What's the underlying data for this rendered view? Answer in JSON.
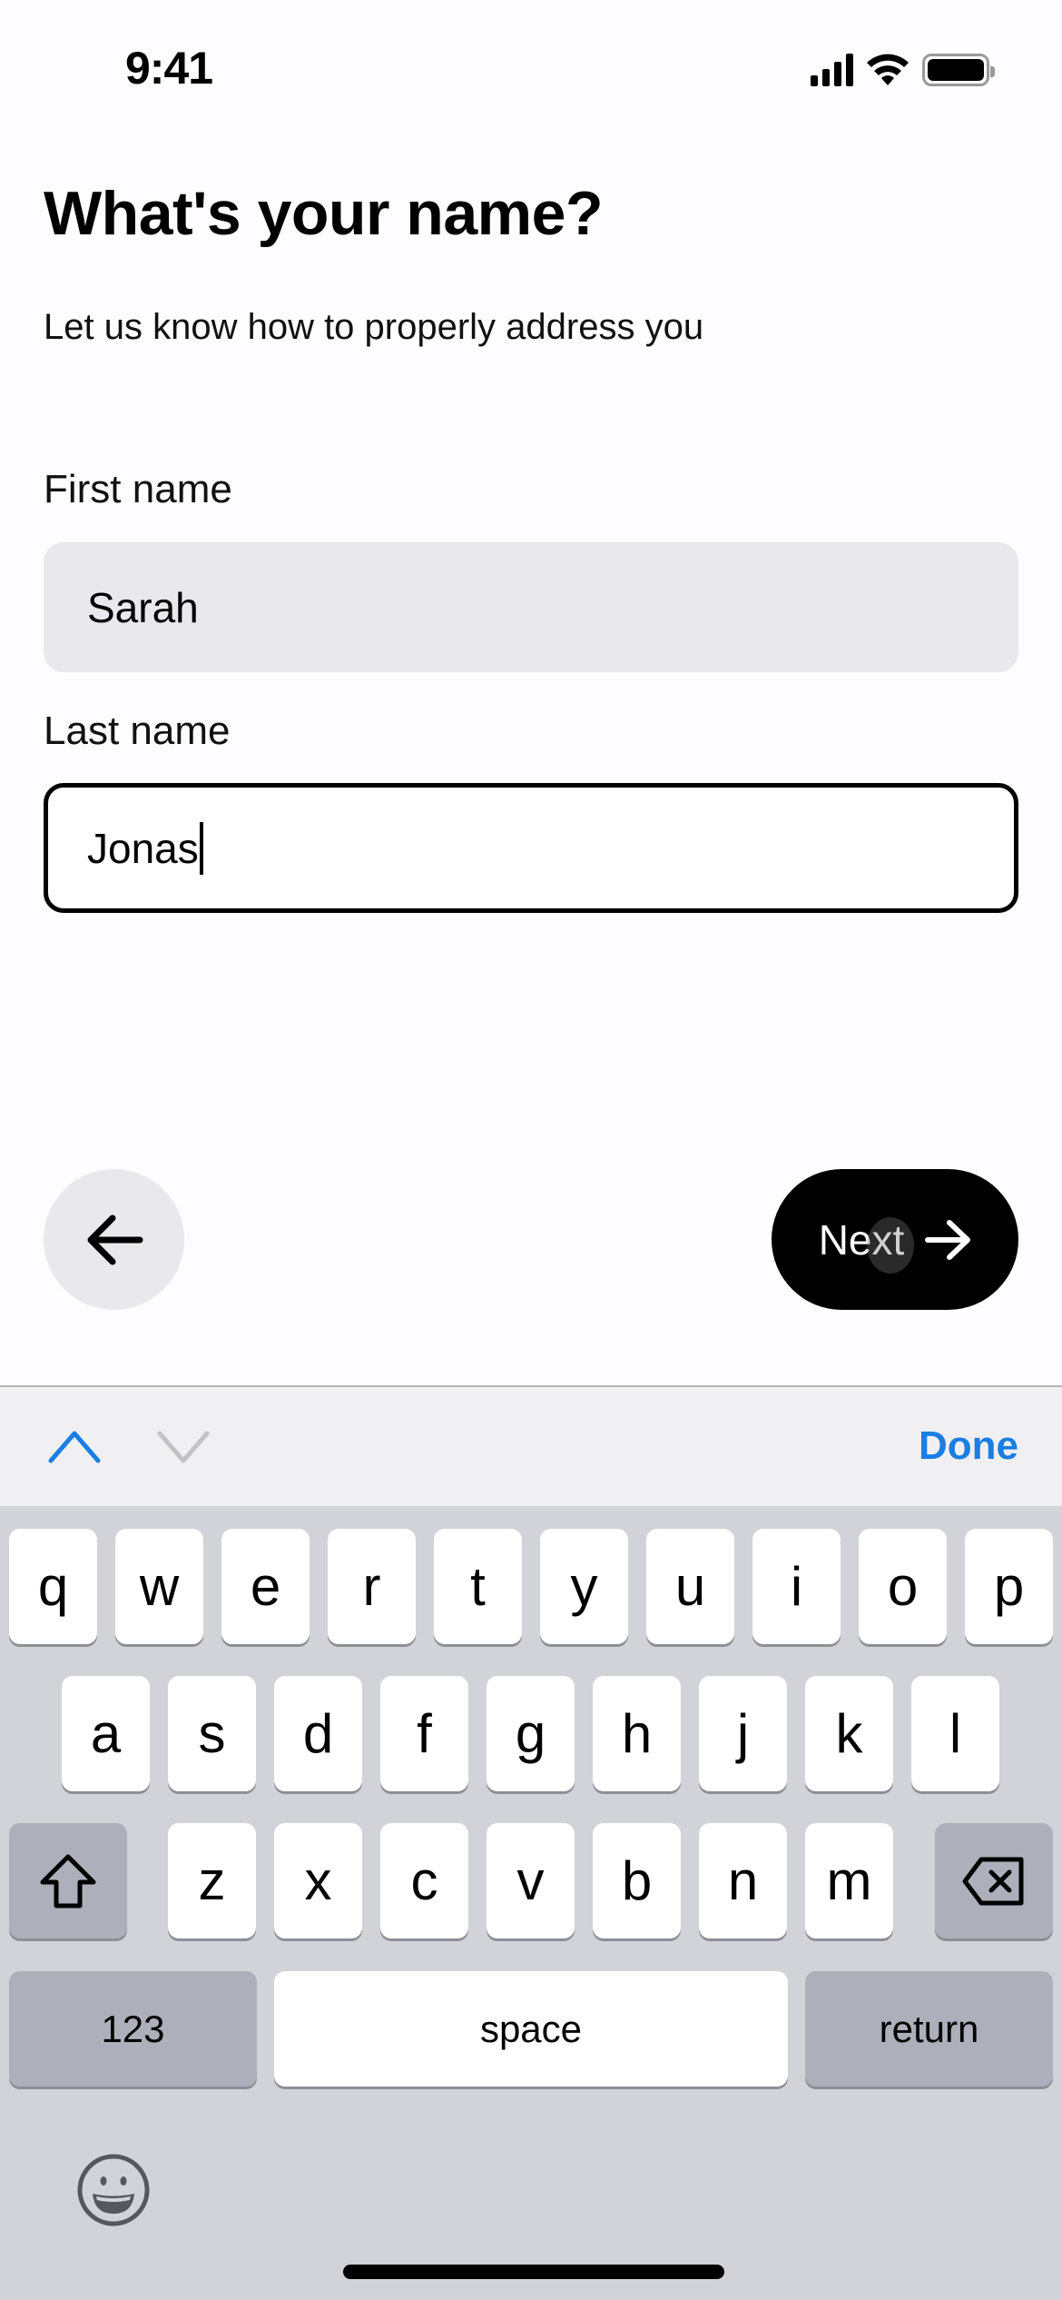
{
  "status_bar": {
    "time": "9:41",
    "icons": [
      "cellular-signal-icon",
      "wifi-icon",
      "battery-icon"
    ]
  },
  "header": {
    "title": "What's your name?",
    "subtitle": "Let us know how to properly address you"
  },
  "form": {
    "first_name": {
      "label": "First name",
      "value": "Sarah",
      "focused": false
    },
    "last_name": {
      "label": "Last name",
      "value": "Jonas",
      "focused": true
    }
  },
  "navigation": {
    "back_icon": "arrow-left-icon",
    "next_label": "Next",
    "next_icon": "arrow-right-icon"
  },
  "keyboard_accessory": {
    "previous_icon": "chevron-up-icon",
    "next_icon": "chevron-down-icon",
    "done_label": "Done"
  },
  "keyboard": {
    "row1": [
      "q",
      "w",
      "e",
      "r",
      "t",
      "y",
      "u",
      "i",
      "o",
      "p"
    ],
    "row2": [
      "a",
      "s",
      "d",
      "f",
      "g",
      "h",
      "j",
      "k",
      "l"
    ],
    "row3": [
      "z",
      "x",
      "c",
      "v",
      "b",
      "n",
      "m"
    ],
    "numbers_label": "123",
    "space_label": "space",
    "return_label": "return",
    "shift_icon": "shift-icon",
    "delete_icon": "delete-backspace-icon",
    "emoji_icon": "emoji-smiley-icon"
  },
  "colors": {
    "accent": "#1a7ee3",
    "primary_button": "#000000",
    "field_background": "#e9e8ec",
    "keyboard_background": "#d2d3d8"
  }
}
